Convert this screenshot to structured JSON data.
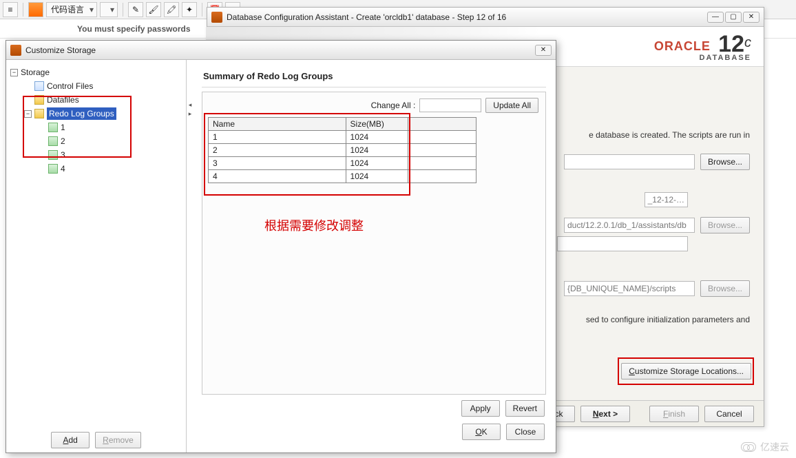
{
  "toolbar": {
    "combo1_label": "代码语言",
    "instruction": "You must specify passwords"
  },
  "dbca": {
    "title": "Database Configuration Assistant - Create 'orcldb1' database - Step 12 of 16",
    "oracle_brand": "ORACLE",
    "oracle_sub": "DATABASE",
    "oracle_version": "12",
    "oracle_suffix": "c",
    "body_line1": "e database is created. The scripts are run in",
    "field1_value": "_12-12-…",
    "field2_value": "duct/12.2.0.1/db_1/assistants/db",
    "field3_value": "{DB_UNIQUE_NAME}/scripts",
    "body_line2": "sed to configure initialization parameters and",
    "browse": "Browse...",
    "customize": "Customize Storage Locations...",
    "back": "< Back",
    "next": "Next >",
    "finish": "Finish",
    "cancel": "Cancel"
  },
  "cstor": {
    "title": "Customize Storage",
    "tree_root": "Storage",
    "ctrl_files": "Control Files",
    "datafiles": "Datafiles",
    "rlg": "Redo Log Groups",
    "rlg_items": [
      "1",
      "2",
      "3",
      "4"
    ],
    "add": "Add",
    "remove": "Remove",
    "panel_title": "Summary of Redo Log Groups",
    "change_all": "Change All :",
    "update_all": "Update All",
    "col_name": "Name",
    "col_size": "Size(MB)",
    "rows": [
      {
        "name": "1",
        "size": "1024"
      },
      {
        "name": "2",
        "size": "1024"
      },
      {
        "name": "3",
        "size": "1024"
      },
      {
        "name": "4",
        "size": "1024"
      }
    ],
    "annotation": "根据需要修改调整",
    "apply": "Apply",
    "revert": "Revert",
    "ok": "OK",
    "close": "Close"
  },
  "watermark": "亿速云"
}
